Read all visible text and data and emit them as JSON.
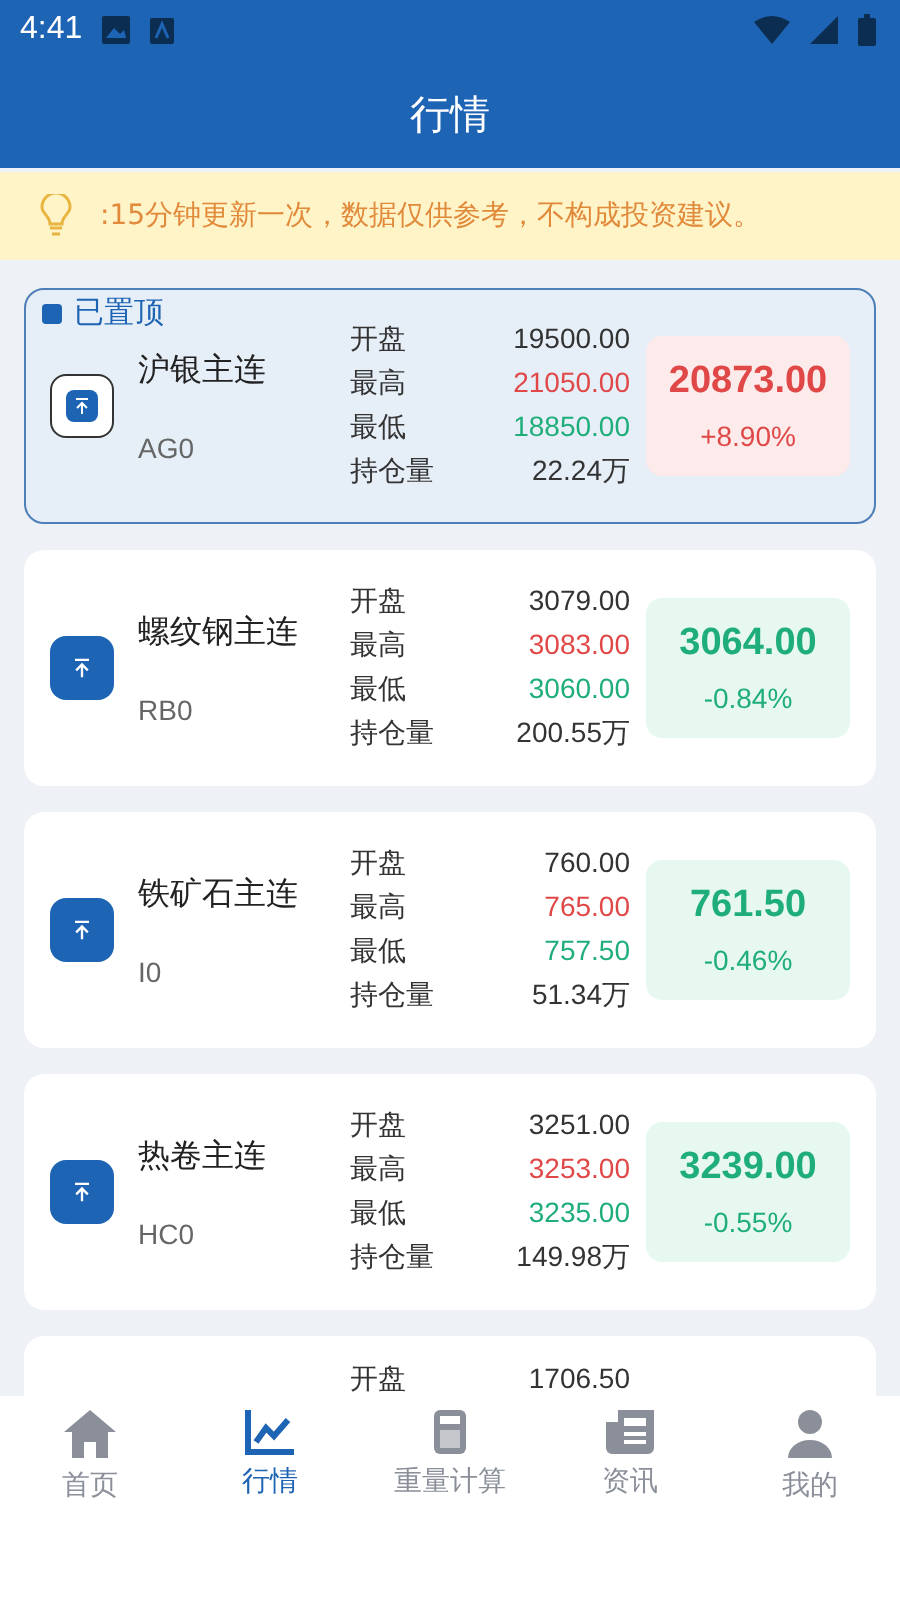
{
  "status_bar": {
    "time": "4:41"
  },
  "header": {
    "title": "行情"
  },
  "notice": {
    "text": ":15分钟更新一次，数据仅供参考，不构成投资建议。"
  },
  "quotes": [
    {
      "pinned": true,
      "pin_label": "已置顶",
      "name": "沪银主连",
      "code": "AG0",
      "open_label": "开盘",
      "open": "19500.00",
      "high_label": "最高",
      "high": "21050.00",
      "low_label": "最低",
      "low": "18850.00",
      "oi_label": "持仓量",
      "oi": "22.24万",
      "price": "20873.00",
      "change": "+8.90%",
      "kind": "up"
    },
    {
      "pinned": false,
      "name": "螺纹钢主连",
      "code": "RB0",
      "open_label": "开盘",
      "open": "3079.00",
      "high_label": "最高",
      "high": "3083.00",
      "low_label": "最低",
      "low": "3060.00",
      "oi_label": "持仓量",
      "oi": "200.55万",
      "price": "3064.00",
      "change": "-0.84%",
      "kind": "down"
    },
    {
      "pinned": false,
      "name": "铁矿石主连",
      "code": "I0",
      "open_label": "开盘",
      "open": "760.00",
      "high_label": "最高",
      "high": "765.00",
      "low_label": "最低",
      "low": "757.50",
      "oi_label": "持仓量",
      "oi": "51.34万",
      "price": "761.50",
      "change": "-0.46%",
      "kind": "down"
    },
    {
      "pinned": false,
      "name": "热卷主连",
      "code": "HC0",
      "open_label": "开盘",
      "open": "3251.00",
      "high_label": "最高",
      "high": "3253.00",
      "low_label": "最低",
      "low": "3235.00",
      "oi_label": "持仓量",
      "oi": "149.98万",
      "price": "3239.00",
      "change": "-0.55%",
      "kind": "down"
    },
    {
      "open_label": "开盘",
      "open": "1706.50"
    }
  ],
  "tabs": [
    {
      "label": "首页",
      "kind": "home",
      "selected": false
    },
    {
      "label": "行情",
      "kind": "chart",
      "selected": true
    },
    {
      "label": "重量计算",
      "kind": "calculator",
      "selected": false
    },
    {
      "label": "资讯",
      "kind": "news",
      "selected": false
    },
    {
      "label": "我的",
      "kind": "person",
      "selected": false
    }
  ]
}
